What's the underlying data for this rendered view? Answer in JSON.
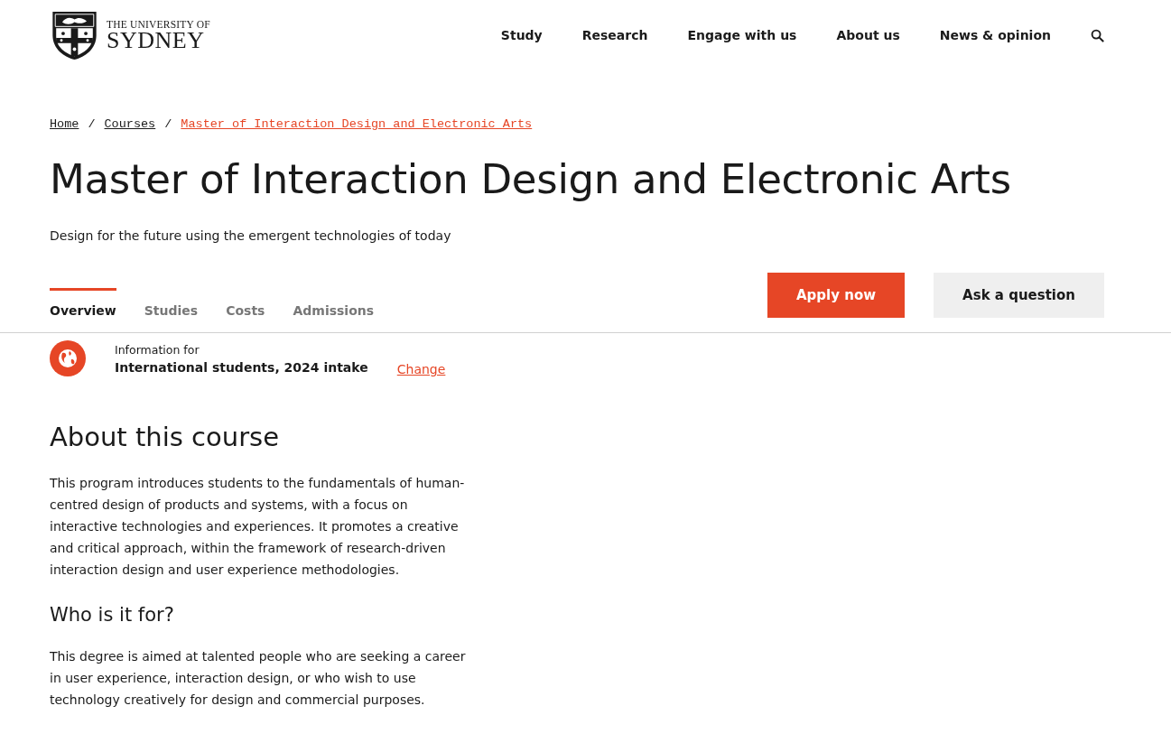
{
  "logo": {
    "line_1": "THE UNIVERSITY OF",
    "line_2": "SYDNEY"
  },
  "nav": [
    "Study",
    "Research",
    "Engage with us",
    "About us",
    "News & opinion"
  ],
  "breadcrumb": [
    {
      "label": "Home",
      "selected": false
    },
    {
      "label": "Courses",
      "selected": false
    },
    {
      "label": "Master of Interaction Design and Electronic Arts",
      "selected": true
    }
  ],
  "breadcrumb_separator": "/",
  "title": "Master of Interaction Design and Electronic Arts",
  "subtitle": "Design for the future using the emergent technologies of today",
  "tabs": [
    {
      "label": "Overview",
      "selected": true
    },
    {
      "label": "Studies",
      "selected": false
    },
    {
      "label": "Costs",
      "selected": false
    },
    {
      "label": "Admissions",
      "selected": false
    }
  ],
  "buttons": [
    {
      "label": "Apply now",
      "kind": "primary"
    },
    {
      "label": "Ask a question",
      "kind": "secondary"
    }
  ],
  "info": {
    "label": "Information for",
    "value": "International students, 2024 intake",
    "link": "Change"
  },
  "sections": [
    {
      "heading": "About this course",
      "kind": "heading",
      "paragraph": "This program introduces students to the fundamentals of human-centred design of products and systems, with a focus on interactive technologies and experiences. It promotes a creative and critical approach, within the framework of research-driven interaction design and user experience methodologies."
    },
    {
      "heading": "Who is it for?",
      "kind": "subheading",
      "paragraph": "This degree is aimed at talented people who are seeking a career in user experience, interaction design, or who wish to use technology creatively for design and commercial purposes."
    }
  ]
}
